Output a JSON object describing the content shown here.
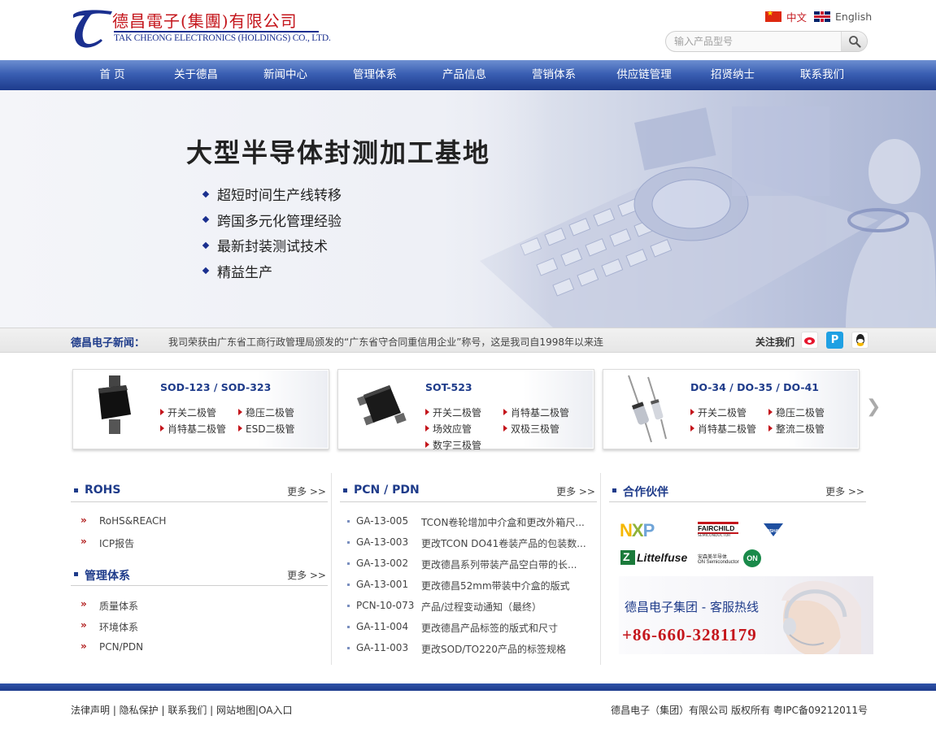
{
  "brand": {
    "name_cn": "德昌電子(集團)有限公司",
    "name_en": "TAK CHEONG ELECTRONICS (HOLDINGS) CO., LTD."
  },
  "lang": {
    "cn": "中文",
    "en": "English"
  },
  "search": {
    "placeholder": "输入产品型号"
  },
  "nav": [
    "首 页",
    "关于德昌",
    "新闻中心",
    "管理体系",
    "产品信息",
    "营销体系",
    "供应链管理",
    "招贤纳士",
    "联系我们"
  ],
  "banner": {
    "title": "大型半导体封测加工基地",
    "bullets": [
      "超短时间生产线转移",
      "跨国多元化管理经验",
      "最新封装测试技术",
      "精益生产"
    ]
  },
  "newsbar": {
    "label": "德昌电子新闻：",
    "text": "我司荣获由广东省工商行政管理局颁发的“广东省守合同重信用企业”称号，这是我司自1998年以来连",
    "follow": "关注我们"
  },
  "products": [
    {
      "title": "SOD-123 / SOD-323",
      "links": [
        "开关二极管",
        "稳压二极管",
        "肖特基二极管",
        "ESD二极管"
      ]
    },
    {
      "title": "SOT-523",
      "links": [
        "开关二极管",
        "肖特基二极管",
        "场效应管",
        "双极三极管",
        "数字三极管"
      ]
    },
    {
      "title": "DO-34 / DO-35 / DO-41",
      "links": [
        "开关二极管",
        "稳压二极管",
        "肖特基二极管",
        "整流二极管"
      ]
    }
  ],
  "rohs": {
    "title": "ROHS",
    "more": "更多 >>",
    "links": [
      "RoHS&REACH",
      "ICP报告"
    ]
  },
  "mgmt": {
    "title": "管理体系",
    "more": "更多 >>",
    "links": [
      "质量体系",
      "环境体系",
      "PCN/PDN"
    ]
  },
  "pcn": {
    "title": "PCN / PDN",
    "more": "更多 >>",
    "rows": [
      {
        "code": "GA-13-005",
        "desc": "TCON卷轮增加中介盒和更改外箱尺..."
      },
      {
        "code": "GA-13-003",
        "desc": "更改TCON DO41卷装产品的包装数..."
      },
      {
        "code": "GA-13-002",
        "desc": "更改德昌系列带装产品空白带的长..."
      },
      {
        "code": "GA-13-001",
        "desc": "更改德昌52mm带装中介盒的版式"
      },
      {
        "code": "PCN-10-073",
        "desc": "产品/过程变动通知（最终）"
      },
      {
        "code": "GA-11-004",
        "desc": "更改德昌产品标签的版式和尺寸"
      },
      {
        "code": "GA-11-003",
        "desc": "更改SOD/TO220产品的标签规格"
      }
    ]
  },
  "partners": {
    "title": "合作伙伴",
    "more": "更多 >>",
    "logos": {
      "nxp": "NXP",
      "fairchild": "FAIRCHILD",
      "fairchild_sub": "SEMICONDUCTOR",
      "vishay": "VISHAY",
      "littelfuse": "Littelfuse",
      "onsemi": "ON Semiconductor",
      "onsemi_cn": "安森美半导体",
      "on": "ON"
    }
  },
  "hotline": {
    "title": "德昌电子集团 - 客服热线",
    "number": "+86-660-3281179"
  },
  "footer": {
    "left": "法律声明 | 隐私保护 | 联系我们 | 网站地图|OA入口",
    "right": "德昌电子（集团）有限公司 版权所有 粤IPC备09212011号"
  },
  "colors": {
    "brand_blue": "#1e3b8a",
    "brand_red": "#c4161c",
    "nav_top": "#6d8fd1",
    "nav_bottom": "#1d3b8c"
  }
}
